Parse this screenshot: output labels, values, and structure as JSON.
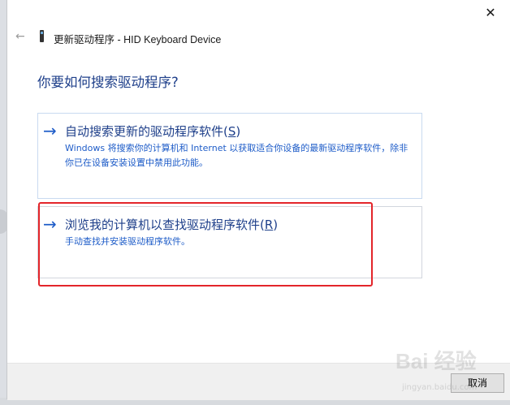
{
  "window": {
    "title": "更新驱动程序 - HID Keyboard Device",
    "close_glyph": "✕",
    "back_glyph": "←"
  },
  "main": {
    "question": "你要如何搜索驱动程序?"
  },
  "options": [
    {
      "arrow": "→",
      "title_main": "自动搜索更新的驱动程序软件(",
      "title_key": "S",
      "title_end": ")",
      "description": "Windows 将搜索你的计算机和 Internet 以获取适合你设备的最新驱动程序软件，除非你已在设备安装设置中禁用此功能。"
    },
    {
      "arrow": "→",
      "title_main": "浏览我的计算机以查找驱动程序软件(",
      "title_key": "R",
      "title_end": ")",
      "description": "手动查找并安装驱动程序软件。"
    }
  ],
  "footer": {
    "cancel_label": "取消"
  },
  "watermark": {
    "text": "Bai 经验",
    "subtext": "jingyan.baidu.com"
  },
  "colors": {
    "accent": "#1e5cc8",
    "heading": "#1e3f8a",
    "highlight": "#e3252a"
  }
}
